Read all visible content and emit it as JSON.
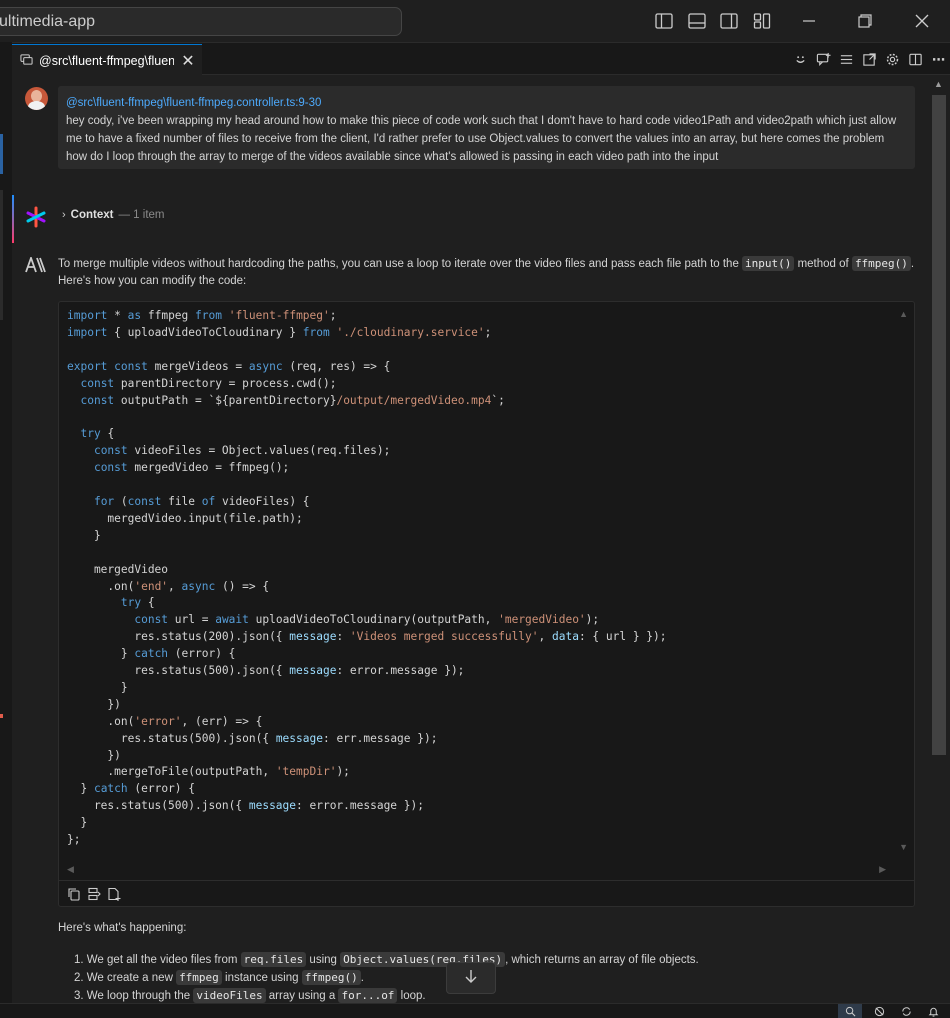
{
  "window": {
    "title_search": "ultimedia-app"
  },
  "tab": {
    "label": "@src\\fluent-ffmpeg\\fluent...",
    "close": "✕"
  },
  "user_message": {
    "reference": "@src\\fluent-ffmpeg\\fluent-ffmpeg.controller.ts:9-30",
    "text": "hey cody, i've been wrapping my head around how to make this piece of code work such that I dom't have to hard code video1Path and video2path which just allow me to have a fixed number of files to receive from the client, I'd rather prefer to use Object.values to convert the values into an array, but here comes the problem how do I loop through the array to merge of the videos available since what's allowed is passing in each video path into the input"
  },
  "context": {
    "title": "Context",
    "count": "— 1 item"
  },
  "answer": {
    "intro_a": "To merge multiple videos without hardcoding the paths, you can use a loop to iterate over the video files and pass each file path to the ",
    "code_input": "input()",
    "intro_b": " method of ",
    "code_ffmpeg": "ffmpeg()",
    "intro_c": ".",
    "intro_line2": "Here's how you can modify the code:"
  },
  "happening": "Here's what's happening:",
  "steps": {
    "s1a": "1. We get all the video files from ",
    "s1code1": "req.files",
    "s1b": " using ",
    "s1code2": "Object.values(req.files)",
    "s1c": ", which returns an array of file objects.",
    "s2a": "2. We create a new ",
    "s2code1": "ffmpeg",
    "s2b": " instance using ",
    "s2code2": "ffmpeg()",
    "s2c": ".",
    "s3a": "3. We loop through the ",
    "s3code1": "videoFiles",
    "s3b": " array using a ",
    "s3code2": "for...of",
    "s3c": " loop."
  },
  "colors": {
    "accent": "#0078d4",
    "link": "#4daafc",
    "keyword": "#569cd6",
    "string": "#ce9178",
    "property": "#9cdcfe"
  },
  "icons": [
    "layout-sidebar-left-icon",
    "layout-panel-icon",
    "layout-sidebar-right-icon",
    "layout-customize-icon",
    "minimize-icon",
    "restore-icon",
    "close-icon",
    "cody-logo-icon",
    "claude-logo-icon",
    "copy-icon",
    "insert-icon",
    "new-file-icon",
    "arrow-down-icon"
  ]
}
